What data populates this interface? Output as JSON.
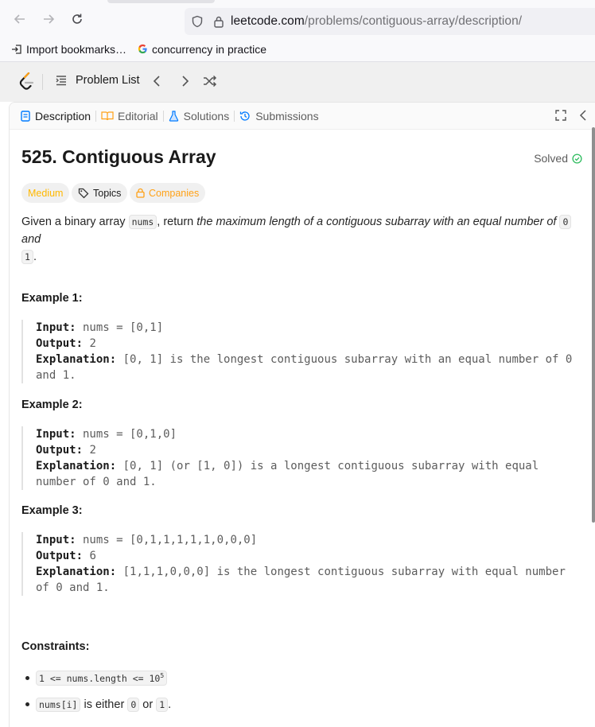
{
  "browser": {
    "url_domain": "leetcode.com",
    "url_path": "/problems/contiguous-array/description/",
    "bookmarks": [
      "Import bookmarks…",
      "concurrency in practice"
    ]
  },
  "lc_nav": {
    "problem_list": "Problem List"
  },
  "tabs": {
    "description": "Description",
    "editorial": "Editorial",
    "solutions": "Solutions",
    "submissions": "Submissions"
  },
  "problem": {
    "title": "525. Contiguous Array",
    "status": "Solved",
    "difficulty": "Medium",
    "topics": "Topics",
    "companies": "Companies",
    "desc_prefix": "Given a binary array ",
    "desc_code": "nums",
    "desc_mid": ", return ",
    "desc_em": "the maximum length of a contiguous subarray with an equal number of ",
    "desc_zero": "0",
    "desc_and": " and",
    "desc_one": "1",
    "desc_end": "."
  },
  "examples": [
    {
      "title": "Example 1:",
      "input_label": "Input:",
      "input": " nums = [0,1]",
      "output_label": "Output:",
      "output": " 2",
      "expl_label": "Explanation:",
      "expl_line1": " [0, 1] is the longest contiguous subarray with an equal number of 0",
      "expl_line2": "and 1."
    },
    {
      "title": "Example 2:",
      "input_label": "Input:",
      "input": " nums = [0,1,0]",
      "output_label": "Output:",
      "output": " 2",
      "expl_label": "Explanation:",
      "expl_line1": " [0, 1] (or [1, 0]) is a longest contiguous subarray with equal",
      "expl_line2": "number of 0 and 1."
    },
    {
      "title": "Example 3:",
      "input_label": "Input:",
      "input": " nums = [0,1,1,1,1,1,0,0,0]",
      "output_label": "Output:",
      "output": " 6",
      "expl_label": "Explanation:",
      "expl_line1": " [1,1,1,0,0,0] is the longest contiguous subarray with equal number",
      "expl_line2": "of 0 and 1."
    }
  ],
  "constraints": {
    "title": "Constraints:",
    "c1_code": "1 <= nums.length <= 10",
    "c1_sup": "5",
    "c2_code": "nums[i]",
    "c2_text1": " is either ",
    "c2_zero": "0",
    "c2_or": " or ",
    "c2_one": "1",
    "c2_end": "."
  },
  "colors": {
    "medium": "#ffb800",
    "solved": "#2cbb5d",
    "companies": "#ffa116"
  }
}
